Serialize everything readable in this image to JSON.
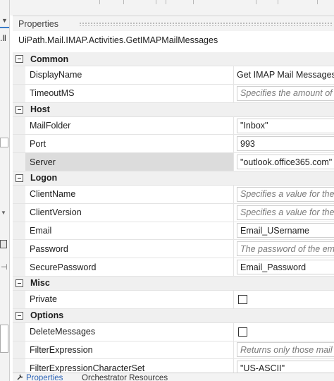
{
  "panel": {
    "title": "Properties",
    "type_name": "UiPath.Mail.IMAP.Activities.GetIMAPMailMessages"
  },
  "left_pane": {
    "partial_text": ".ll"
  },
  "categories": [
    {
      "label": "Common",
      "rows": [
        {
          "name": "DisplayName",
          "value": "Get IMAP Mail Messages",
          "kind": "text"
        },
        {
          "name": "TimeoutMS",
          "value": "Specifies the amount of time",
          "kind": "placeholder"
        }
      ]
    },
    {
      "label": "Host",
      "rows": [
        {
          "name": "MailFolder",
          "value": "\"Inbox\"",
          "kind": "text"
        },
        {
          "name": "Port",
          "value": "993",
          "kind": "text"
        },
        {
          "name": "Server",
          "value": "\"outlook.office365.com\"",
          "kind": "text",
          "selected": true
        }
      ]
    },
    {
      "label": "Logon",
      "rows": [
        {
          "name": "ClientName",
          "value": "Specifies a value for the client",
          "kind": "placeholder"
        },
        {
          "name": "ClientVersion",
          "value": "Specifies a value for the client",
          "kind": "placeholder"
        },
        {
          "name": "Email",
          "value": "Email_USername",
          "kind": "text"
        },
        {
          "name": "Password",
          "value": "The password of the email",
          "kind": "placeholder"
        },
        {
          "name": "SecurePassword",
          "value": "Email_Password",
          "kind": "text"
        }
      ]
    },
    {
      "label": "Misc",
      "rows": [
        {
          "name": "Private",
          "value": "",
          "kind": "checkbox"
        }
      ]
    },
    {
      "label": "Options",
      "rows": [
        {
          "name": "DeleteMessages",
          "value": "",
          "kind": "checkbox"
        },
        {
          "name": "FilterExpression",
          "value": "Returns only those mail",
          "kind": "placeholder"
        },
        {
          "name": "FilterExpressionCharacterSet",
          "value": "\"US-ASCII\"",
          "kind": "text"
        }
      ]
    }
  ],
  "tabs": [
    {
      "label": "Properties",
      "active": true
    },
    {
      "label": "Orchestrator Resources",
      "active": false
    }
  ],
  "colors": {
    "accent": "#2a62b5",
    "selected_row": "#dcdcdc",
    "category_bg": "#f0f0f0"
  }
}
